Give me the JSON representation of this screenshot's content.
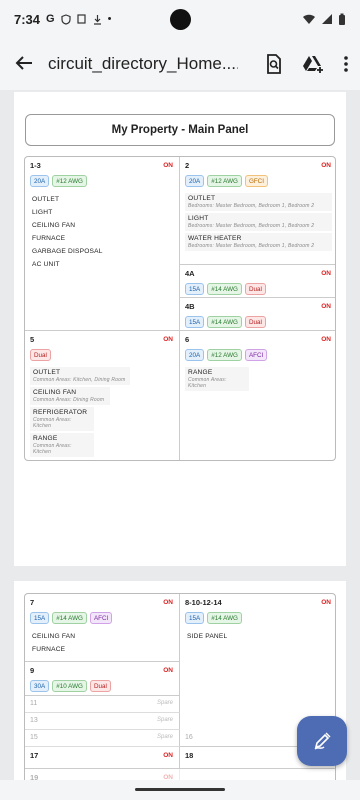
{
  "status": {
    "time": "7:34",
    "g": "G"
  },
  "appbar": {
    "title": "circuit_directory_Home...."
  },
  "page1": {
    "panel_title": "My Property - Main Panel",
    "circuits": [
      {
        "num": "1-3",
        "state": "ON",
        "tags": [
          "20A",
          "#12 AWG"
        ],
        "loads": [
          "OUTLET",
          "LIGHT",
          "CEILING FAN",
          "FURNACE",
          "GARBAGE DISPOSAL",
          "AC UNIT"
        ]
      },
      {
        "num": "2",
        "state": "ON",
        "tags": [
          "20A",
          "#12 AWG",
          "GFCI"
        ],
        "loads": [
          {
            "name": "OUTLET",
            "sub": "Bedrooms: Master Bedroom, Bedroom 1, Bedroom 2"
          },
          {
            "name": "LIGHT",
            "sub": "Bedrooms: Master Bedroom, Bedroom 1, Bedroom 2"
          },
          {
            "name": "WATER HEATER",
            "sub": "Bedrooms: Master Bedroom, Bedroom 1, Bedroom 2"
          }
        ]
      },
      {
        "num": "4A",
        "state": "ON",
        "tags": [
          "15A",
          "#14 AWG",
          "Dual"
        ]
      },
      {
        "num": "4B",
        "state": "ON",
        "tags": [
          "15A",
          "#14 AWG",
          "Dual"
        ]
      },
      {
        "num": "5",
        "state": "ON",
        "tags": [
          "Dual"
        ],
        "loads": [
          {
            "name": "OUTLET",
            "sub": "Common Areas: Kitchen, Dining Room"
          },
          {
            "name": "CEILING FAN",
            "sub": "Common Areas: Dining Room"
          },
          {
            "name": "REFRIGERATOR",
            "sub": "Common Areas: Kitchen"
          },
          {
            "name": "RANGE",
            "sub": "Common Areas: Kitchen"
          }
        ]
      },
      {
        "num": "6",
        "state": "ON",
        "tags": [
          "20A",
          "#12 AWG",
          "AFCI"
        ],
        "loads": [
          {
            "name": "RANGE",
            "sub": "Common Areas: Kitchen"
          }
        ]
      }
    ]
  },
  "page2": {
    "circuits": [
      {
        "num": "7",
        "state": "ON",
        "tags": [
          "15A",
          "#14 AWG",
          "AFCI"
        ],
        "loads": [
          "CEILING FAN",
          "FURNACE"
        ]
      },
      {
        "num": "8-10-12-14",
        "state": "ON",
        "tags": [
          "15A",
          "#14 AWG"
        ],
        "loads": [
          "SIDE PANEL"
        ]
      },
      {
        "num": "9",
        "state": "ON",
        "tags": [
          "30A",
          "#10 AWG",
          "Dual"
        ]
      },
      {
        "num": "11",
        "spare": "Spare"
      },
      {
        "num": "13",
        "spare": "Spare"
      },
      {
        "num": "15",
        "spare": "Spare"
      },
      {
        "num": "16"
      },
      {
        "num": "17",
        "state": "ON"
      },
      {
        "num": "18",
        "state": "ON"
      },
      {
        "num": "19",
        "state": "ON"
      }
    ]
  }
}
